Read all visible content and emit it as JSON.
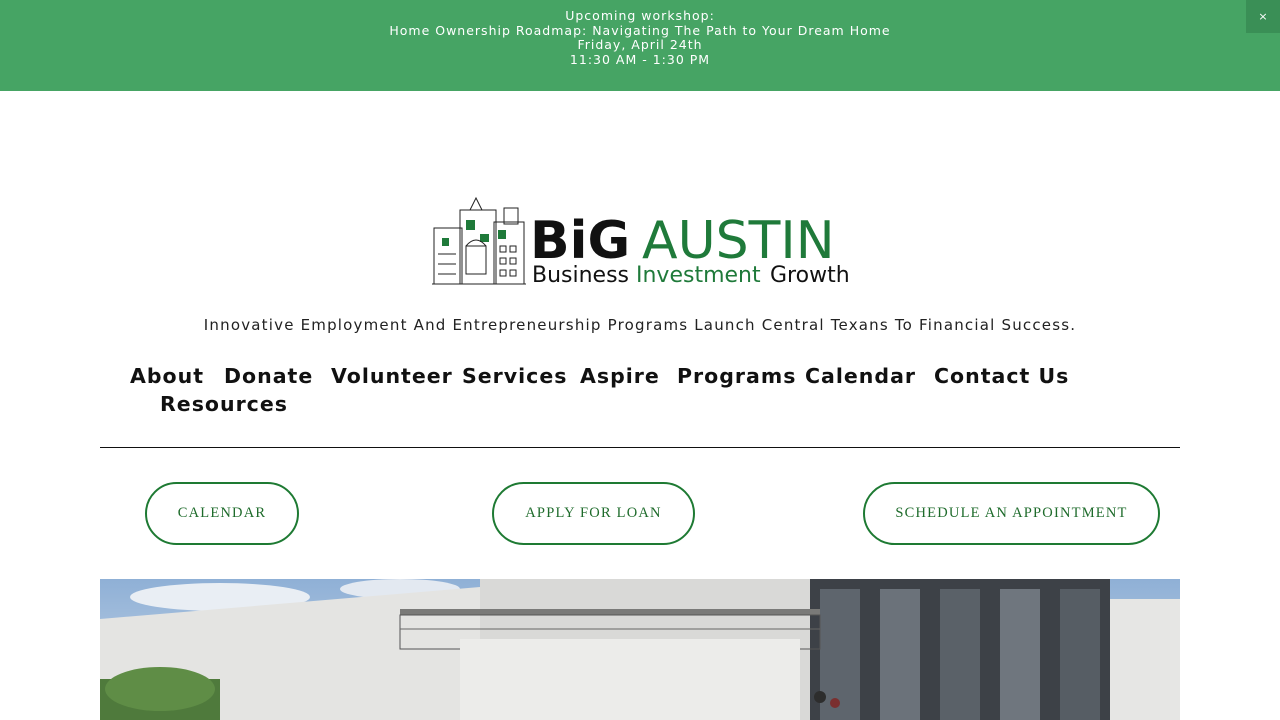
{
  "announcement": {
    "lines": [
      "Upcoming workshop:",
      "Home Ownership Roadmap: Navigating The Path to Your Dream Home",
      "Friday, April 24th",
      "11:30 AM - 1:30 PM"
    ],
    "close_label": "×"
  },
  "logo": {
    "word1": "BiG",
    "word2": "AUSTIN",
    "sub1": "Business",
    "sub2": "Investment",
    "sub3": "Growth",
    "color_dark": "#111111",
    "color_green": "#1f7a3a"
  },
  "tagline": "Innovative Employment And Entrepreneurship Programs Launch Central Texans To Financial Success.",
  "nav": {
    "items": [
      "About",
      "Donate",
      "Volunteer",
      "Services",
      "Aspire",
      "Programs",
      "Calendar",
      "Contact Us",
      "Resources"
    ]
  },
  "cta": {
    "calendar": "CALENDAR",
    "apply": "APPLY FOR LOAN",
    "schedule": "SCHEDULE AN APPOINTMENT"
  },
  "colors": {
    "announcement_bg": "#46a464",
    "accent_green": "#1e7a33"
  }
}
